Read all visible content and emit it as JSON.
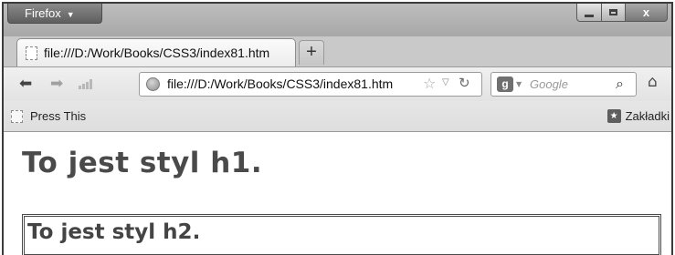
{
  "window": {
    "app_button_label": "Firefox",
    "app_button_caret": "▼",
    "close_label": "x"
  },
  "tabs": [
    {
      "label": "file:///D:/Work/Books/CSS3/index81.htm"
    }
  ],
  "newtab_label": "+",
  "navbar": {
    "url": "file:///D:/Work/Books/CSS3/index81.htm",
    "search_placeholder": "Google",
    "search_engine_letter": "g"
  },
  "bookmarks": {
    "left_item": "Press This",
    "right_item": "Zakładki"
  },
  "content": {
    "h1": "To jest styl h1.",
    "h2": "To jest styl h2."
  },
  "icons": {
    "back": "back-arrow-icon",
    "forward": "forward-arrow-icon",
    "signal": "signal-icon",
    "globe": "globe-icon",
    "star": "star-icon",
    "reload": "reload-icon",
    "search": "search-icon",
    "home": "home-icon",
    "bookmark": "bookmark-star-icon"
  },
  "colors": {
    "chrome_background": "#c9c9c9",
    "text": "#4a4a4a"
  }
}
